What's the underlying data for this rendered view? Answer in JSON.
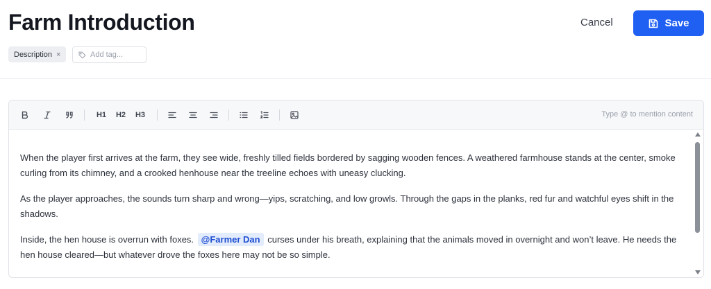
{
  "header": {
    "title": "Farm Introduction",
    "cancel_label": "Cancel",
    "save_label": "Save"
  },
  "tags": {
    "items": [
      {
        "label": "Description",
        "remove": "×"
      }
    ],
    "add_placeholder": "Add tag..."
  },
  "toolbar": {
    "buttons": [
      "bold-icon",
      "italic-icon",
      "quote-icon",
      "H1",
      "H2",
      "H3",
      "align-left-icon",
      "align-center-icon",
      "align-right-icon",
      "bullet-list-icon",
      "numbered-list-icon",
      "image-icon"
    ],
    "h1": "H1",
    "h2": "H2",
    "h3": "H3",
    "mention_hint": "Type @ to mention content"
  },
  "content": {
    "p1": "When the player first arrives at the farm, they see wide, freshly tilled fields bordered by sagging wooden fences. A weathered farmhouse stands at the center, smoke curling from its chimney, and a crooked henhouse near the treeline echoes with uneasy clucking.",
    "p2": "As the player approaches, the sounds turn sharp and wrong—yips, scratching, and low growls. Through the gaps in the planks, red fur and watchful eyes shift in the shadows.",
    "p3_before": "Inside, the hen house is overrun with foxes.",
    "p3_mention": "@Farmer Dan",
    "p3_after": "curses under his breath, explaining that the animals moved in overnight and won’t leave. He needs the hen house cleared—but whatever drove the foxes here may not be so simple."
  },
  "colors": {
    "accent": "#1f5ff2",
    "mention_bg": "#e3ecfd",
    "mention_text": "#1f4fd1"
  }
}
